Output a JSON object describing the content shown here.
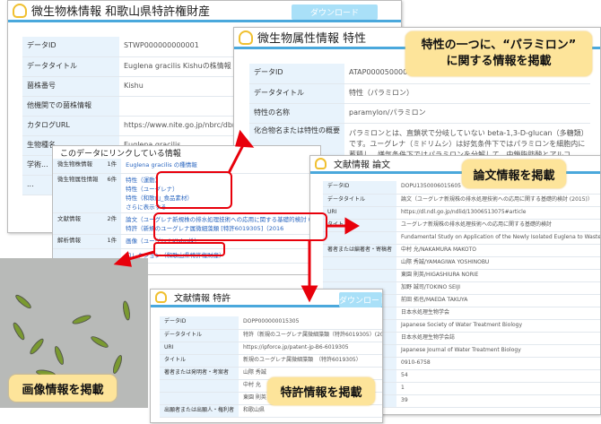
{
  "strain": {
    "title": "微生物株情報 和歌山県特許権財産",
    "download": "ダウンロード",
    "rows": [
      [
        "データID",
        "STWP000000000001"
      ],
      [
        "データタイトル",
        "Euglena gracilis Kishuの株情報"
      ],
      [
        "菌株番号",
        "Kishu"
      ],
      [
        "他機関での菌株情報",
        ""
      ],
      [
        "カタログURL",
        "https://www.nite.go.jp/nbrc/dbrp/d"
      ],
      [
        "生物種名",
        "Euglena gracilis"
      ],
      [
        "学術...",
        ""
      ],
      [
        "...",
        ""
      ]
    ]
  },
  "trait": {
    "title": "微生物属性情報 特性",
    "rows": [
      [
        "データID",
        "ATAP0000500000"
      ],
      [
        "データタイトル",
        "特性（パラミロン）"
      ],
      [
        "特性の名称",
        "paramylon/パラミロン"
      ],
      [
        "化合物名または特性の概要",
        "パラミロンとは、直鎖状で分岐していない beta-1,3-D-glucan（多糖類）です。ユーグレナ（ミドリムシ）は好気条件下ではパラミロンを細胞内に蓄積し、嫌気条件下ではパラミロンを分解して、中鎖脂肪酸とアルコ"
      ]
    ]
  },
  "linked": {
    "title": "このデータにリンクしている情報",
    "rows": [
      {
        "label": "微生物株情報",
        "count": "1件",
        "items": [
          "Euglena gracilis の種情報"
        ]
      },
      {
        "label": "微生物属性情報",
        "count": "6件",
        "items": [
          "特性（運動）",
          "特性（ユーグレナ）",
          "特性（和歌山_食品素材）",
          "さらに表示する"
        ]
      },
      {
        "label": "文献情報",
        "count": "2件",
        "items": [
          "論文（ユーグレナ新規株の排水処理技術への応用に関する基礎的検討 (2015)）",
          "特許（新規のユーグレナ属微細藻類 [特許6019305]（2016"
        ]
      },
      {
        "label": "解析情報",
        "count": "1件",
        "items": [
          "画像（ユーグレナKishu株）"
        ]
      },
      {
        "label": "",
        "count": "",
        "items": [
          "コレクション（和歌山県特許権財産）"
        ]
      }
    ]
  },
  "paper": {
    "title": "文献情報 論文",
    "rows": [
      [
        "データID",
        "DOPU1350006015605"
      ],
      [
        "データタイトル",
        "論文（ユーグレナ新規株の排水処理技術への応用に関する基礎的検討 (2015)）"
      ],
      [
        "URI",
        "https://dl.ndl.go.jp/ndlid/13006513075#article"
      ],
      [
        "タイトル",
        "ユーグレナ新規株の排水処理技術への応用に関する基礎的検討"
      ],
      [
        "",
        "Fundamental Study on Application of the Newly Isolated Euglena to Wastewater Treatment"
      ],
      [
        "著者または編著者・寄稿者",
        "中村 允/NAKAMURA MAKOTO"
      ],
      [
        "",
        "山際 秀誠/YAMAGIWA YOSHINOBU"
      ],
      [
        "",
        "東園 則英/HIGASHIURA NORIE"
      ],
      [
        "",
        "加野 誠司/TOKINO SEIJI"
      ],
      [
        "",
        "前田 拓也/MAEDA TAKUYA"
      ],
      [
        "発行者または機関者",
        "日本水処理生物学会"
      ],
      [
        "",
        "Japanese Society of Water Treatment Biology"
      ],
      [
        "",
        "日本水処理生物学会誌"
      ],
      [
        "",
        "Japanese Journal of Water Treatment Biology"
      ],
      [
        "",
        "0910-6758"
      ],
      [
        "",
        "54"
      ],
      [
        "",
        "1"
      ],
      [
        "",
        "39"
      ]
    ]
  },
  "patent": {
    "title": "文献情報 特許",
    "download": "ダウンロード",
    "rows": [
      [
        "データID",
        "DOPP000000015305"
      ],
      [
        "データタイトル",
        "特許（新規のユーグレナ属微細藻類（特許6019305）(2016)）"
      ],
      [
        "URI",
        "https://ipforce.jp/patent-jp-B6-6019305"
      ],
      [
        "タイトル",
        "新規のユーグレナ属微細藻類　（特許6019305）"
      ],
      [
        "著者または発明者・考案者",
        "山際 秀誠"
      ],
      [
        "",
        "中村 允"
      ],
      [
        "",
        "東園 則英"
      ],
      [
        "出願者または出願人・権利者",
        "和歌山県"
      ]
    ]
  },
  "callouts": {
    "trait": "特性の一つに、“パラミロン”\nに関する情報を掲載",
    "paper": "論文情報を掲載",
    "image": "画像情報を掲載",
    "patent": "特許情報を掲載"
  },
  "colors": {
    "accent": "#4aa8dc",
    "callout": "#fde49a",
    "highlight": "#e8000b"
  }
}
